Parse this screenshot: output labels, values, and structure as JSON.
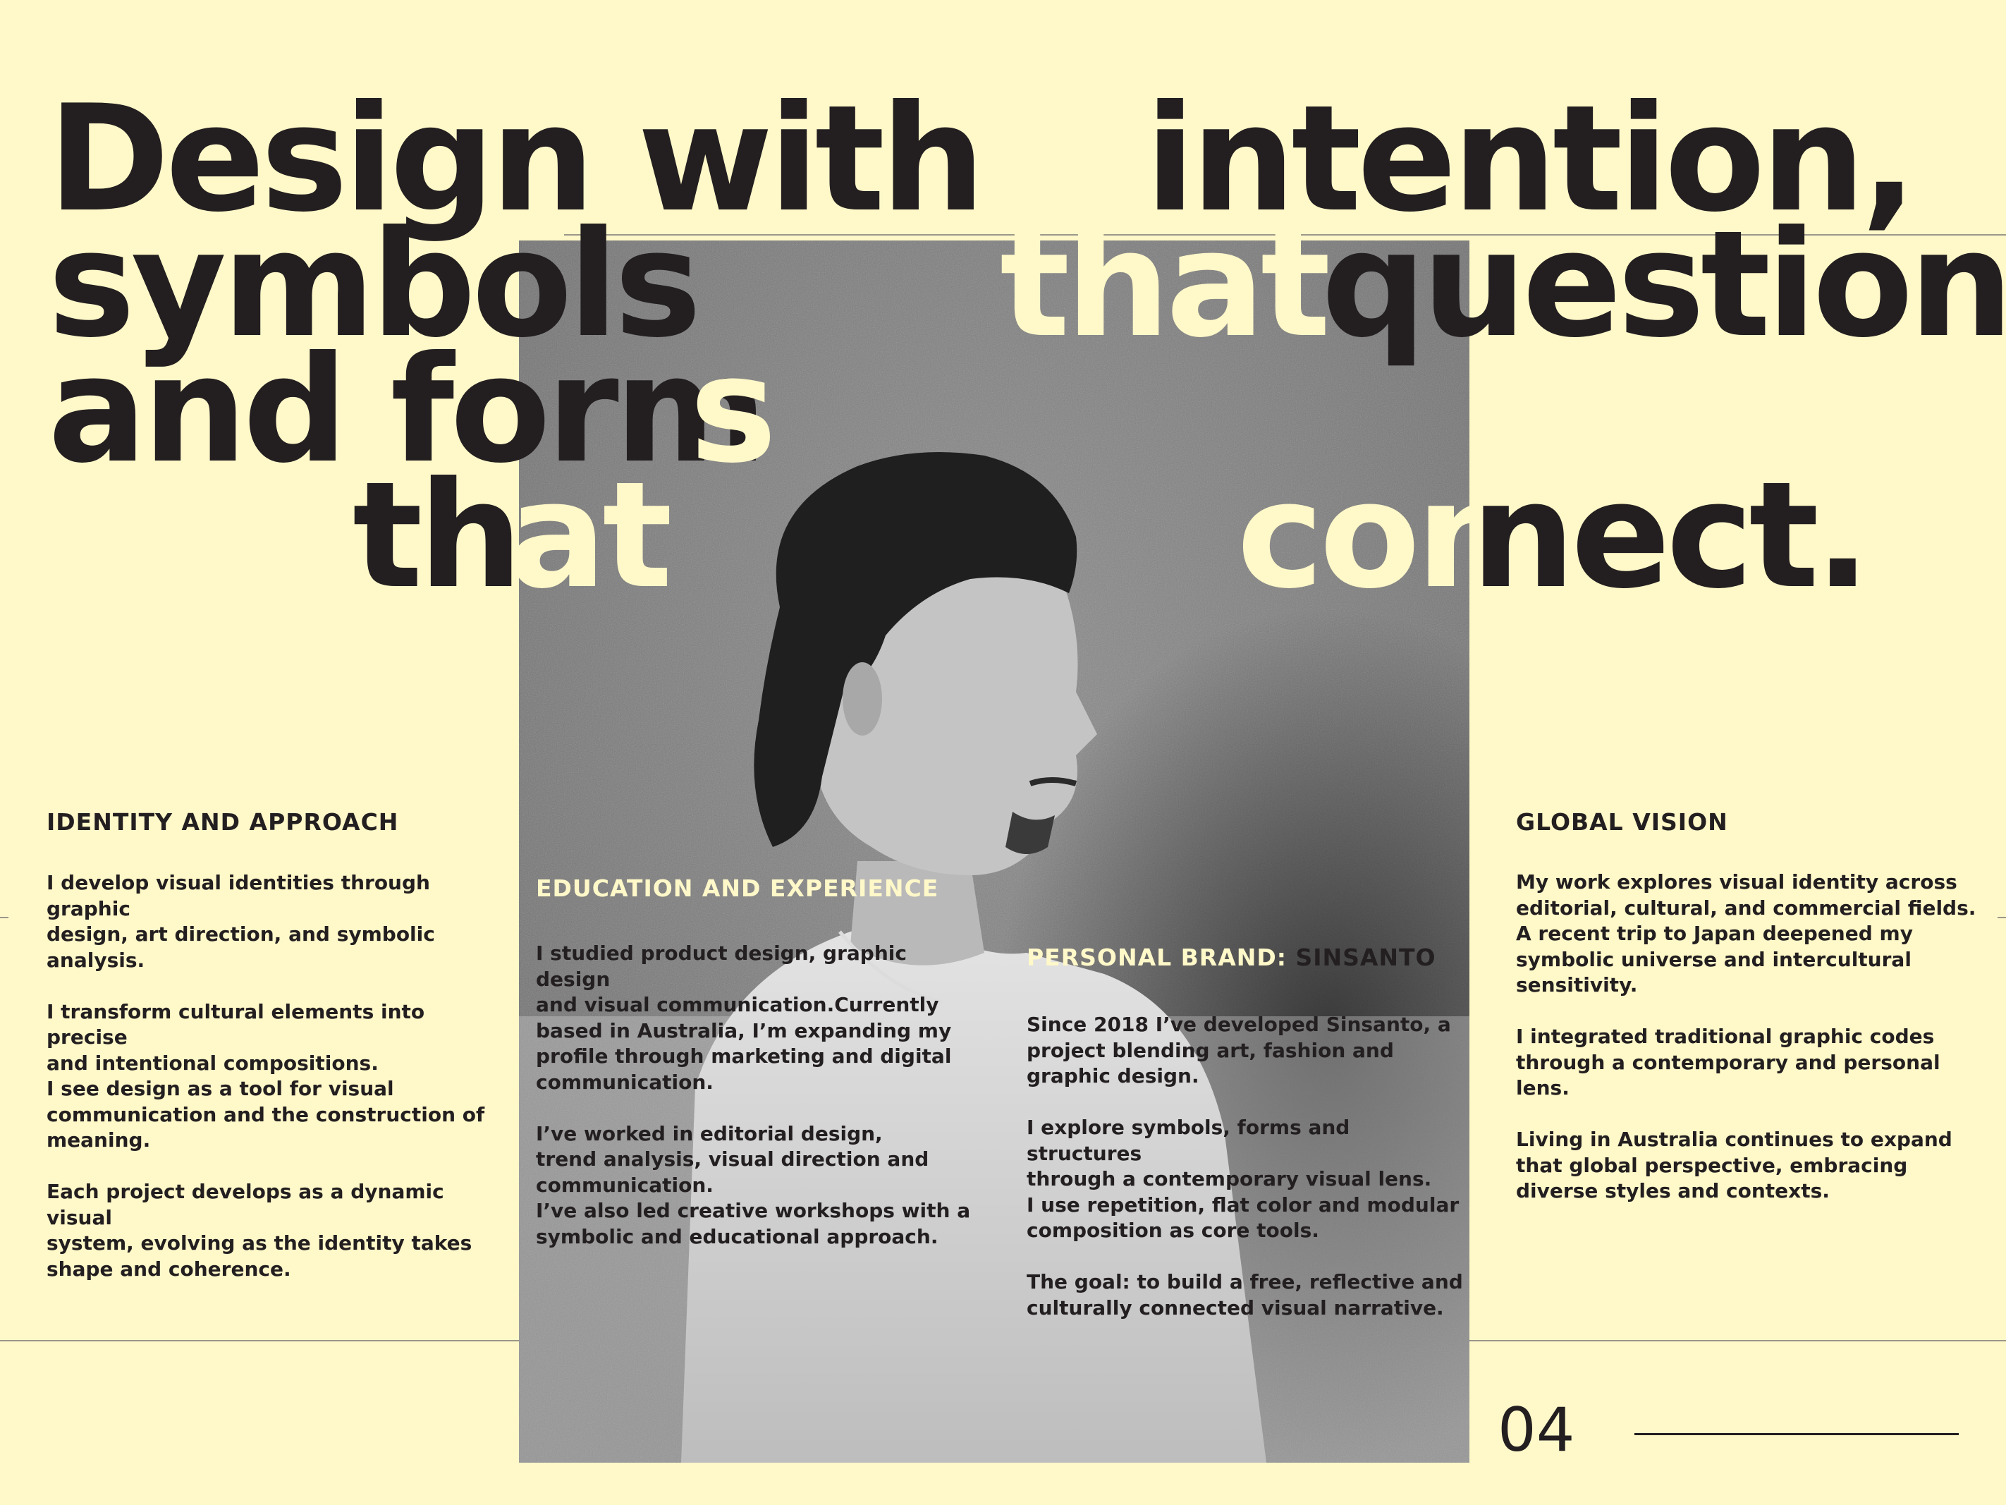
{
  "headline": {
    "line1": {
      "a": "Design with",
      "b": "intention,"
    },
    "line2": {
      "a": "symbols",
      "b_light": "that",
      "c": "question"
    },
    "line3": {
      "a": "and form",
      "b_light": "s"
    },
    "line4": {
      "a": "th",
      "b_light": "at",
      "c_light": "con",
      "d": "nect."
    }
  },
  "sections": {
    "identity": {
      "title": "IDENTITY AND APPROACH",
      "body": "I develop visual identities through graphic\ndesign, art direction, and symbolic\nanalysis.\n\nI transform cultural elements into precise\nand intentional compositions.\nI see design as a tool for visual\ncommunication and the construction of\nmeaning.\n\nEach project develops as a dynamic visual\nsystem, evolving as the identity takes\nshape and coherence."
    },
    "education": {
      "title": "EDUCATION AND EXPERIENCE",
      "body": "I studied product design, graphic design\nand visual communication.Currently\nbased in Australia, I’m expanding my\nprofile through marketing and digital\ncommunication.\n\n I’ve worked in editorial design,\ntrend analysis, visual direction and\ncommunication.\nI’ve also led creative workshops with a\nsymbolic and educational approach."
    },
    "brand": {
      "title_prefix": "PERSONAL BRAND: ",
      "title_name": "SINSANTO",
      "body": "Since 2018 I’ve developed Sinsanto, a\nproject blending art, fashion and\ngraphic design.\n\nI explore symbols, forms and structures\nthrough a contemporary visual lens.\nI use repetition, flat color and modular\ncomposition as core tools.\n\nThe goal: to build a free, reflective and\nculturally connected visual narrative."
    },
    "global": {
      "title": "GLOBAL VISION",
      "body": "My work explores visual identity across\neditorial, cultural, and commercial fields.\nA recent trip to Japan deepened my\nsymbolic universe and intercultural\nsensitivity.\n\nI integrated traditional graphic codes\nthrough a contemporary and personal\nlens.\n\nLiving in Australia continues to expand\nthat global perspective, embracing\ndiverse styles and contexts."
    }
  },
  "page_number": "04",
  "colors": {
    "background": "#fff8c9",
    "text": "#231f20",
    "accent_light": "#fff8c9"
  }
}
